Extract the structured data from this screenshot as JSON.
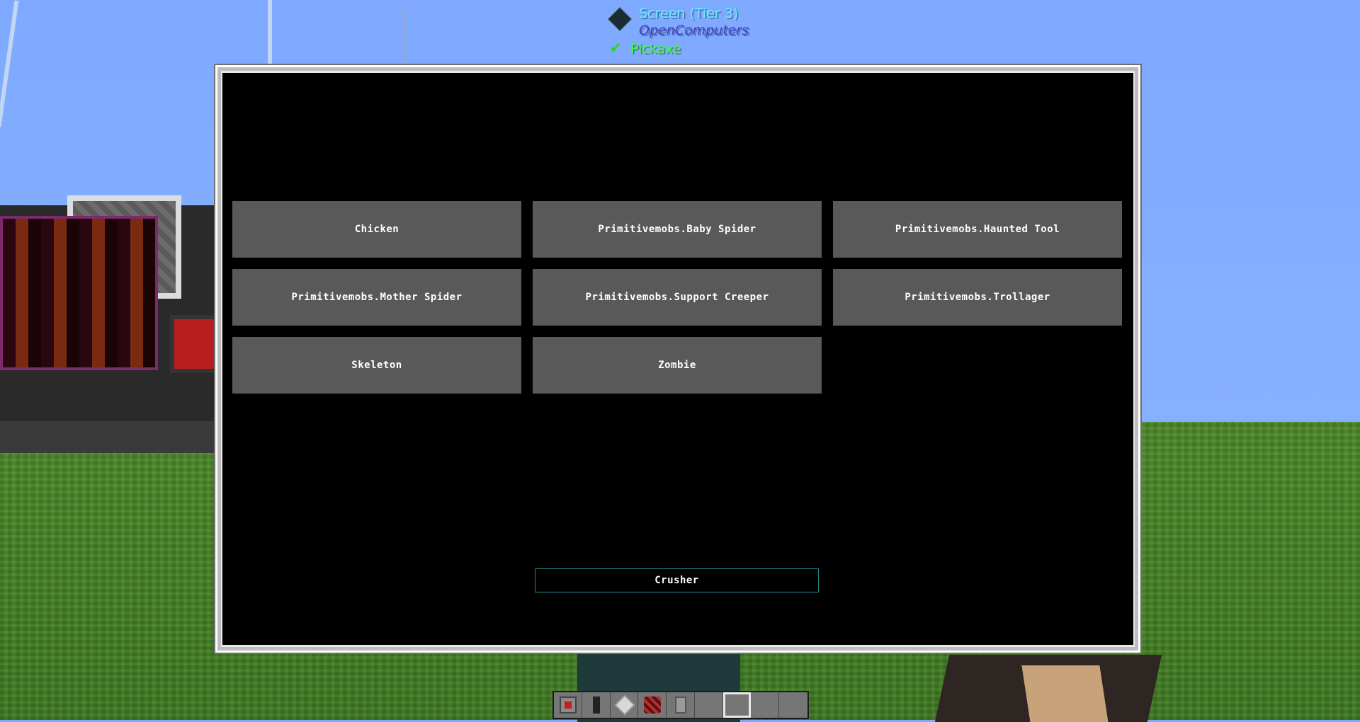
{
  "tooltip": {
    "item_name": "Screen (Tier 3)",
    "mod_name": "OpenComputers",
    "tool": "Pickaxe",
    "colors": {
      "name": "#5ef2ff",
      "mod": "#4040c8",
      "tool": "#38ff38"
    }
  },
  "screen": {
    "mob_buttons": [
      "Chicken",
      "Primitivemobs.Baby Spider",
      "Primitivemobs.Haunted Tool",
      "Primitivemobs.Mother Spider",
      "Primitivemobs.Support Creeper",
      "Primitivemobs.Trollager",
      "Skeleton",
      "Zombie"
    ],
    "action_button": "Crusher",
    "colors": {
      "button_bg": "#595959",
      "action_border": "#1f8a88"
    }
  },
  "hotbar": {
    "selected_slot": 7,
    "slots": [
      {
        "icon": "red-block-icon"
      },
      {
        "icon": "dark-cable-icon"
      },
      {
        "icon": "white-block-icon"
      },
      {
        "icon": "redstone-dust-icon"
      },
      {
        "icon": "grey-canister-icon"
      },
      {
        "icon": ""
      },
      {
        "icon": ""
      },
      {
        "icon": ""
      },
      {
        "icon": ""
      }
    ]
  }
}
